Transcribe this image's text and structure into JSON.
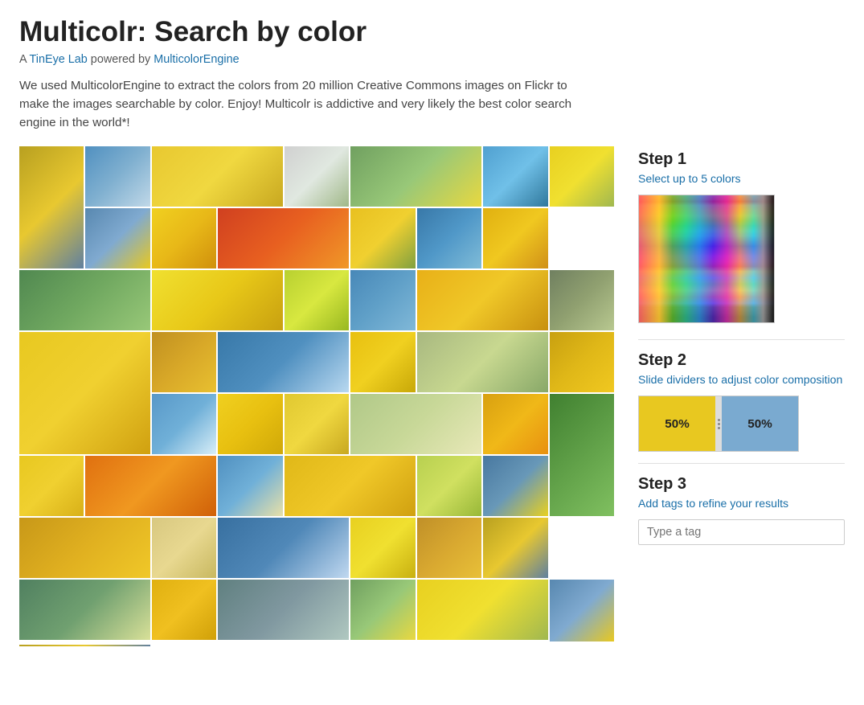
{
  "page": {
    "title": "Multicolr: Search by color",
    "subtitle_prefix": "A ",
    "subtitle_brand": "TinEye Lab",
    "subtitle_middle": " powered by ",
    "subtitle_link": "MulticolorEngine",
    "description": "We used MulticolorEngine to extract the colors from 20 million Creative Commons images on Flickr to make the images searchable by color. Enjoy! Multicolr is addictive and very likely the best color search engine in the world*!"
  },
  "steps": {
    "step1": {
      "heading": "Step 1",
      "subtext": "Select up to 5 colors"
    },
    "step2": {
      "heading": "Step 2",
      "subtext": "Slide dividers to adjust color composition",
      "bar1_label": "50%",
      "bar2_label": "50%"
    },
    "step3": {
      "heading": "Step 3",
      "subtext": "Add tags to refine your results",
      "tag_placeholder": "Type a tag"
    }
  },
  "grid": {
    "cells": [
      {
        "id": 1,
        "color_class": "c1"
      },
      {
        "id": 2,
        "color_class": "c2"
      },
      {
        "id": 3,
        "color_class": "c3"
      },
      {
        "id": 4,
        "color_class": "c4"
      },
      {
        "id": 5,
        "color_class": "c5"
      },
      {
        "id": 6,
        "color_class": "c6"
      },
      {
        "id": 7,
        "color_class": "c7"
      },
      {
        "id": 8,
        "color_class": "c8"
      },
      {
        "id": 9,
        "color_class": "c9"
      },
      {
        "id": 10,
        "color_class": "c10"
      },
      {
        "id": 11,
        "color_class": "c11"
      },
      {
        "id": 12,
        "color_class": "c12"
      },
      {
        "id": 13,
        "color_class": "c13"
      },
      {
        "id": 14,
        "color_class": "c14"
      },
      {
        "id": 15,
        "color_class": "c15"
      },
      {
        "id": 16,
        "color_class": "c16"
      },
      {
        "id": 17,
        "color_class": "c17"
      },
      {
        "id": 18,
        "color_class": "c18"
      },
      {
        "id": 19,
        "color_class": "c19"
      },
      {
        "id": 20,
        "color_class": "c20"
      },
      {
        "id": 21,
        "color_class": "c21"
      },
      {
        "id": 22,
        "color_class": "c22"
      },
      {
        "id": 23,
        "color_class": "c23"
      },
      {
        "id": 24,
        "color_class": "c24"
      },
      {
        "id": 25,
        "color_class": "c25"
      },
      {
        "id": 26,
        "color_class": "c26"
      },
      {
        "id": 27,
        "color_class": "c27"
      },
      {
        "id": 28,
        "color_class": "c28"
      },
      {
        "id": 29,
        "color_class": "c29"
      },
      {
        "id": 30,
        "color_class": "c30"
      },
      {
        "id": 31,
        "color_class": "c31"
      },
      {
        "id": 32,
        "color_class": "c32"
      },
      {
        "id": 33,
        "color_class": "c33"
      },
      {
        "id": 34,
        "color_class": "c34"
      },
      {
        "id": 35,
        "color_class": "c35"
      },
      {
        "id": 36,
        "color_class": "c36"
      },
      {
        "id": 37,
        "color_class": "c37"
      },
      {
        "id": 38,
        "color_class": "c38"
      },
      {
        "id": 39,
        "color_class": "c39"
      },
      {
        "id": 40,
        "color_class": "c40"
      },
      {
        "id": 41,
        "color_class": "c41"
      },
      {
        "id": 42,
        "color_class": "c42"
      },
      {
        "id": 43,
        "color_class": "c43"
      },
      {
        "id": 44,
        "color_class": "c44"
      },
      {
        "id": 45,
        "color_class": "c45"
      }
    ]
  }
}
